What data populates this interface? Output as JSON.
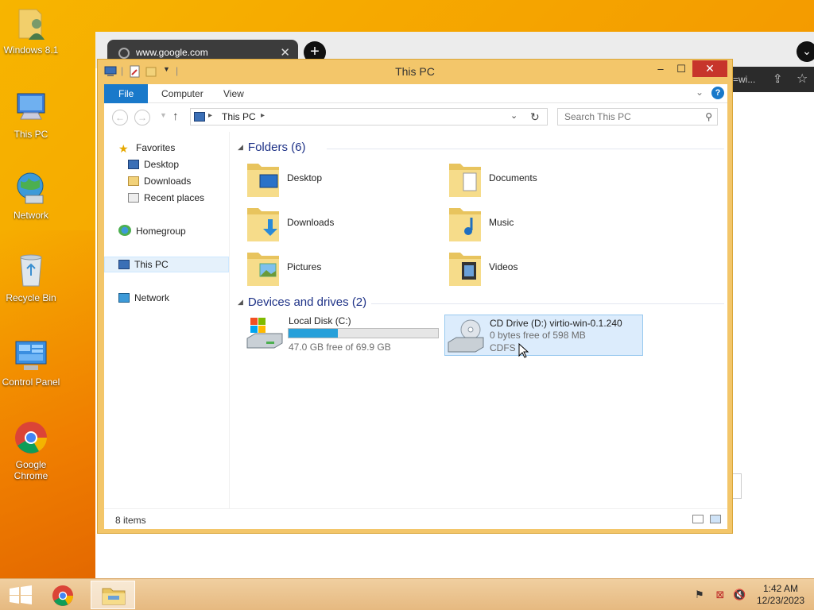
{
  "desktop": {
    "icons": [
      {
        "label": "Windows 8.1"
      },
      {
        "label": "This PC"
      },
      {
        "label": "Network"
      },
      {
        "label": "Recycle Bin"
      },
      {
        "label": "Control Panel"
      },
      {
        "label": "Google Chrome"
      }
    ]
  },
  "browser": {
    "tab_title": "www.google.com",
    "tab_close": "✕",
    "new_tab": "+",
    "url_fragment": "=wi...",
    "menu": "⌄"
  },
  "explorer": {
    "title": "This PC",
    "ribbon": {
      "tabs": [
        "File",
        "Computer",
        "View"
      ],
      "help": "?"
    },
    "address": {
      "crumb": "This PC"
    },
    "search": {
      "placeholder": "Search This PC"
    },
    "nav": {
      "favorites": "Favorites",
      "desktop": "Desktop",
      "downloads": "Downloads",
      "recent": "Recent places",
      "homegroup": "Homegroup",
      "thispc": "This PC",
      "network": "Network"
    },
    "folders": {
      "header": "Folders (6)",
      "items": [
        "Desktop",
        "Documents",
        "Downloads",
        "Music",
        "Pictures",
        "Videos"
      ]
    },
    "devices": {
      "header": "Devices and drives (2)",
      "local": {
        "name": "Local Disk (C:)",
        "free": "47.0 GB free of 69.9 GB",
        "used_fraction": 0.33
      },
      "cd": {
        "name": "CD Drive (D:) virtio-win-0.1.240",
        "free": "0 bytes free of 598 MB",
        "fs": "CDFS"
      }
    },
    "status": {
      "count": "8 items"
    }
  },
  "taskbar": {
    "time": "1:42 AM",
    "date": "12/23/2023"
  },
  "colors": {
    "accent": "#1979ca",
    "frame": "#f3c66a",
    "usage_fill": "#26a0da",
    "close": "#c7352b"
  }
}
